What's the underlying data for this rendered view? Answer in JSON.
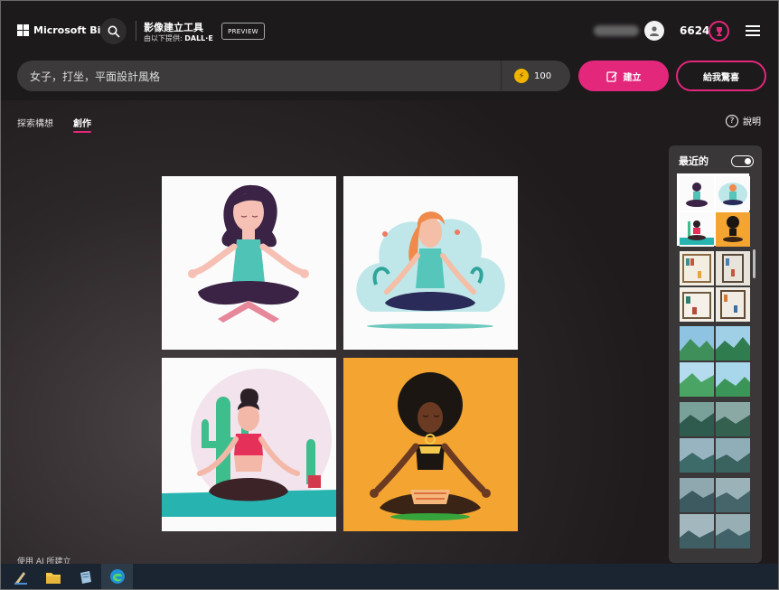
{
  "header": {
    "brand": "Microsoft Bing",
    "app_title": "影像建立工具",
    "app_subtitle_prefix": "由以下提供: ",
    "app_subtitle_provider": "DALL·E",
    "preview_badge": "PREVIEW",
    "points": "6624"
  },
  "prompt": {
    "value": "女子，打坐，平面設計風格",
    "boosts": "100",
    "create_label": "建立",
    "surprise_label": "給我驚喜"
  },
  "tabs": [
    {
      "label": "探索構想"
    },
    {
      "label": "創作"
    }
  ],
  "help_label": "說明",
  "recent": {
    "title": "最近的"
  },
  "footer": "使用 AI 所建立",
  "colors": {
    "accent": "#e3277b",
    "background": "#1c1a1b"
  }
}
